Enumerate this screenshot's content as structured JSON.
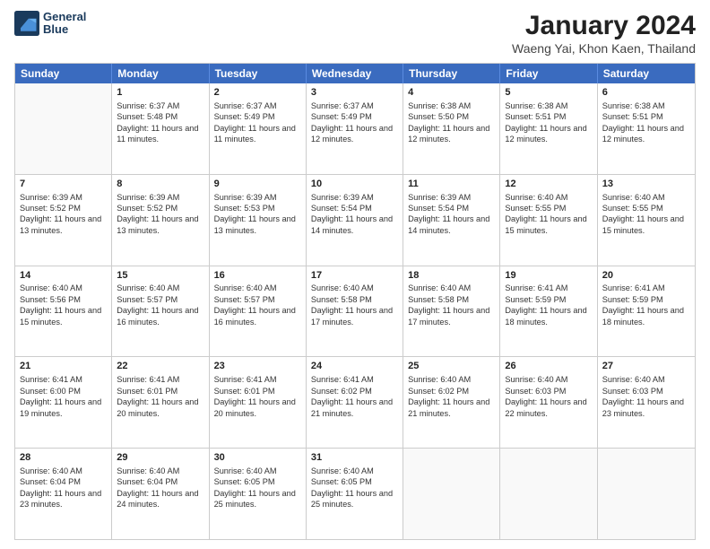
{
  "logo": {
    "line1": "General",
    "line2": "Blue"
  },
  "title": "January 2024",
  "subtitle": "Waeng Yai, Khon Kaen, Thailand",
  "days_of_week": [
    "Sunday",
    "Monday",
    "Tuesday",
    "Wednesday",
    "Thursday",
    "Friday",
    "Saturday"
  ],
  "weeks": [
    [
      {
        "day": "",
        "sunrise": "",
        "sunset": "",
        "daylight": ""
      },
      {
        "day": "1",
        "sunrise": "Sunrise: 6:37 AM",
        "sunset": "Sunset: 5:48 PM",
        "daylight": "Daylight: 11 hours and 11 minutes."
      },
      {
        "day": "2",
        "sunrise": "Sunrise: 6:37 AM",
        "sunset": "Sunset: 5:49 PM",
        "daylight": "Daylight: 11 hours and 11 minutes."
      },
      {
        "day": "3",
        "sunrise": "Sunrise: 6:37 AM",
        "sunset": "Sunset: 5:49 PM",
        "daylight": "Daylight: 11 hours and 12 minutes."
      },
      {
        "day": "4",
        "sunrise": "Sunrise: 6:38 AM",
        "sunset": "Sunset: 5:50 PM",
        "daylight": "Daylight: 11 hours and 12 minutes."
      },
      {
        "day": "5",
        "sunrise": "Sunrise: 6:38 AM",
        "sunset": "Sunset: 5:51 PM",
        "daylight": "Daylight: 11 hours and 12 minutes."
      },
      {
        "day": "6",
        "sunrise": "Sunrise: 6:38 AM",
        "sunset": "Sunset: 5:51 PM",
        "daylight": "Daylight: 11 hours and 12 minutes."
      }
    ],
    [
      {
        "day": "7",
        "sunrise": "Sunrise: 6:39 AM",
        "sunset": "Sunset: 5:52 PM",
        "daylight": "Daylight: 11 hours and 13 minutes."
      },
      {
        "day": "8",
        "sunrise": "Sunrise: 6:39 AM",
        "sunset": "Sunset: 5:52 PM",
        "daylight": "Daylight: 11 hours and 13 minutes."
      },
      {
        "day": "9",
        "sunrise": "Sunrise: 6:39 AM",
        "sunset": "Sunset: 5:53 PM",
        "daylight": "Daylight: 11 hours and 13 minutes."
      },
      {
        "day": "10",
        "sunrise": "Sunrise: 6:39 AM",
        "sunset": "Sunset: 5:54 PM",
        "daylight": "Daylight: 11 hours and 14 minutes."
      },
      {
        "day": "11",
        "sunrise": "Sunrise: 6:39 AM",
        "sunset": "Sunset: 5:54 PM",
        "daylight": "Daylight: 11 hours and 14 minutes."
      },
      {
        "day": "12",
        "sunrise": "Sunrise: 6:40 AM",
        "sunset": "Sunset: 5:55 PM",
        "daylight": "Daylight: 11 hours and 15 minutes."
      },
      {
        "day": "13",
        "sunrise": "Sunrise: 6:40 AM",
        "sunset": "Sunset: 5:55 PM",
        "daylight": "Daylight: 11 hours and 15 minutes."
      }
    ],
    [
      {
        "day": "14",
        "sunrise": "Sunrise: 6:40 AM",
        "sunset": "Sunset: 5:56 PM",
        "daylight": "Daylight: 11 hours and 15 minutes."
      },
      {
        "day": "15",
        "sunrise": "Sunrise: 6:40 AM",
        "sunset": "Sunset: 5:57 PM",
        "daylight": "Daylight: 11 hours and 16 minutes."
      },
      {
        "day": "16",
        "sunrise": "Sunrise: 6:40 AM",
        "sunset": "Sunset: 5:57 PM",
        "daylight": "Daylight: 11 hours and 16 minutes."
      },
      {
        "day": "17",
        "sunrise": "Sunrise: 6:40 AM",
        "sunset": "Sunset: 5:58 PM",
        "daylight": "Daylight: 11 hours and 17 minutes."
      },
      {
        "day": "18",
        "sunrise": "Sunrise: 6:40 AM",
        "sunset": "Sunset: 5:58 PM",
        "daylight": "Daylight: 11 hours and 17 minutes."
      },
      {
        "day": "19",
        "sunrise": "Sunrise: 6:41 AM",
        "sunset": "Sunset: 5:59 PM",
        "daylight": "Daylight: 11 hours and 18 minutes."
      },
      {
        "day": "20",
        "sunrise": "Sunrise: 6:41 AM",
        "sunset": "Sunset: 5:59 PM",
        "daylight": "Daylight: 11 hours and 18 minutes."
      }
    ],
    [
      {
        "day": "21",
        "sunrise": "Sunrise: 6:41 AM",
        "sunset": "Sunset: 6:00 PM",
        "daylight": "Daylight: 11 hours and 19 minutes."
      },
      {
        "day": "22",
        "sunrise": "Sunrise: 6:41 AM",
        "sunset": "Sunset: 6:01 PM",
        "daylight": "Daylight: 11 hours and 20 minutes."
      },
      {
        "day": "23",
        "sunrise": "Sunrise: 6:41 AM",
        "sunset": "Sunset: 6:01 PM",
        "daylight": "Daylight: 11 hours and 20 minutes."
      },
      {
        "day": "24",
        "sunrise": "Sunrise: 6:41 AM",
        "sunset": "Sunset: 6:02 PM",
        "daylight": "Daylight: 11 hours and 21 minutes."
      },
      {
        "day": "25",
        "sunrise": "Sunrise: 6:40 AM",
        "sunset": "Sunset: 6:02 PM",
        "daylight": "Daylight: 11 hours and 21 minutes."
      },
      {
        "day": "26",
        "sunrise": "Sunrise: 6:40 AM",
        "sunset": "Sunset: 6:03 PM",
        "daylight": "Daylight: 11 hours and 22 minutes."
      },
      {
        "day": "27",
        "sunrise": "Sunrise: 6:40 AM",
        "sunset": "Sunset: 6:03 PM",
        "daylight": "Daylight: 11 hours and 23 minutes."
      }
    ],
    [
      {
        "day": "28",
        "sunrise": "Sunrise: 6:40 AM",
        "sunset": "Sunset: 6:04 PM",
        "daylight": "Daylight: 11 hours and 23 minutes."
      },
      {
        "day": "29",
        "sunrise": "Sunrise: 6:40 AM",
        "sunset": "Sunset: 6:04 PM",
        "daylight": "Daylight: 11 hours and 24 minutes."
      },
      {
        "day": "30",
        "sunrise": "Sunrise: 6:40 AM",
        "sunset": "Sunset: 6:05 PM",
        "daylight": "Daylight: 11 hours and 25 minutes."
      },
      {
        "day": "31",
        "sunrise": "Sunrise: 6:40 AM",
        "sunset": "Sunset: 6:05 PM",
        "daylight": "Daylight: 11 hours and 25 minutes."
      },
      {
        "day": "",
        "sunrise": "",
        "sunset": "",
        "daylight": ""
      },
      {
        "day": "",
        "sunrise": "",
        "sunset": "",
        "daylight": ""
      },
      {
        "day": "",
        "sunrise": "",
        "sunset": "",
        "daylight": ""
      }
    ]
  ]
}
